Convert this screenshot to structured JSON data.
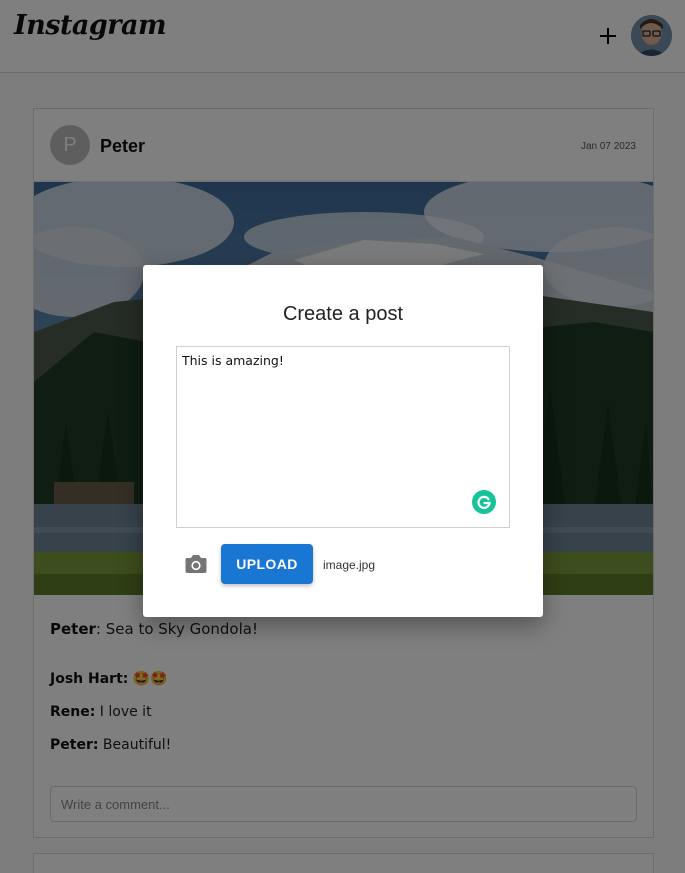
{
  "header": {
    "logo": "Instagram",
    "add_icon": "plus-icon",
    "avatar_icon": "user-avatar"
  },
  "post": {
    "avatar_letter": "P",
    "username": "Peter",
    "date": "Jan 07 2023",
    "caption_user": "Peter",
    "caption_text": ": Sea to Sky Gondola!",
    "comments": [
      {
        "user": "Josh Hart:",
        "text": " 🤩🤩"
      },
      {
        "user": "Rene:",
        "text": " I love it"
      },
      {
        "user": "Peter:",
        "text": " Beautiful!"
      }
    ],
    "comment_placeholder": "Write a comment..."
  },
  "modal": {
    "title": "Create a post",
    "text_value": "This is amazing!",
    "upload_label": "UPLOAD",
    "file_name": "image.jpg",
    "camera_icon": "camera-icon",
    "grammarly_icon": "grammarly-icon"
  },
  "colors": {
    "upload_button": "#1976d2",
    "grammarly": "#15c39a",
    "overlay": "rgba(0,0,0,0.5)"
  }
}
